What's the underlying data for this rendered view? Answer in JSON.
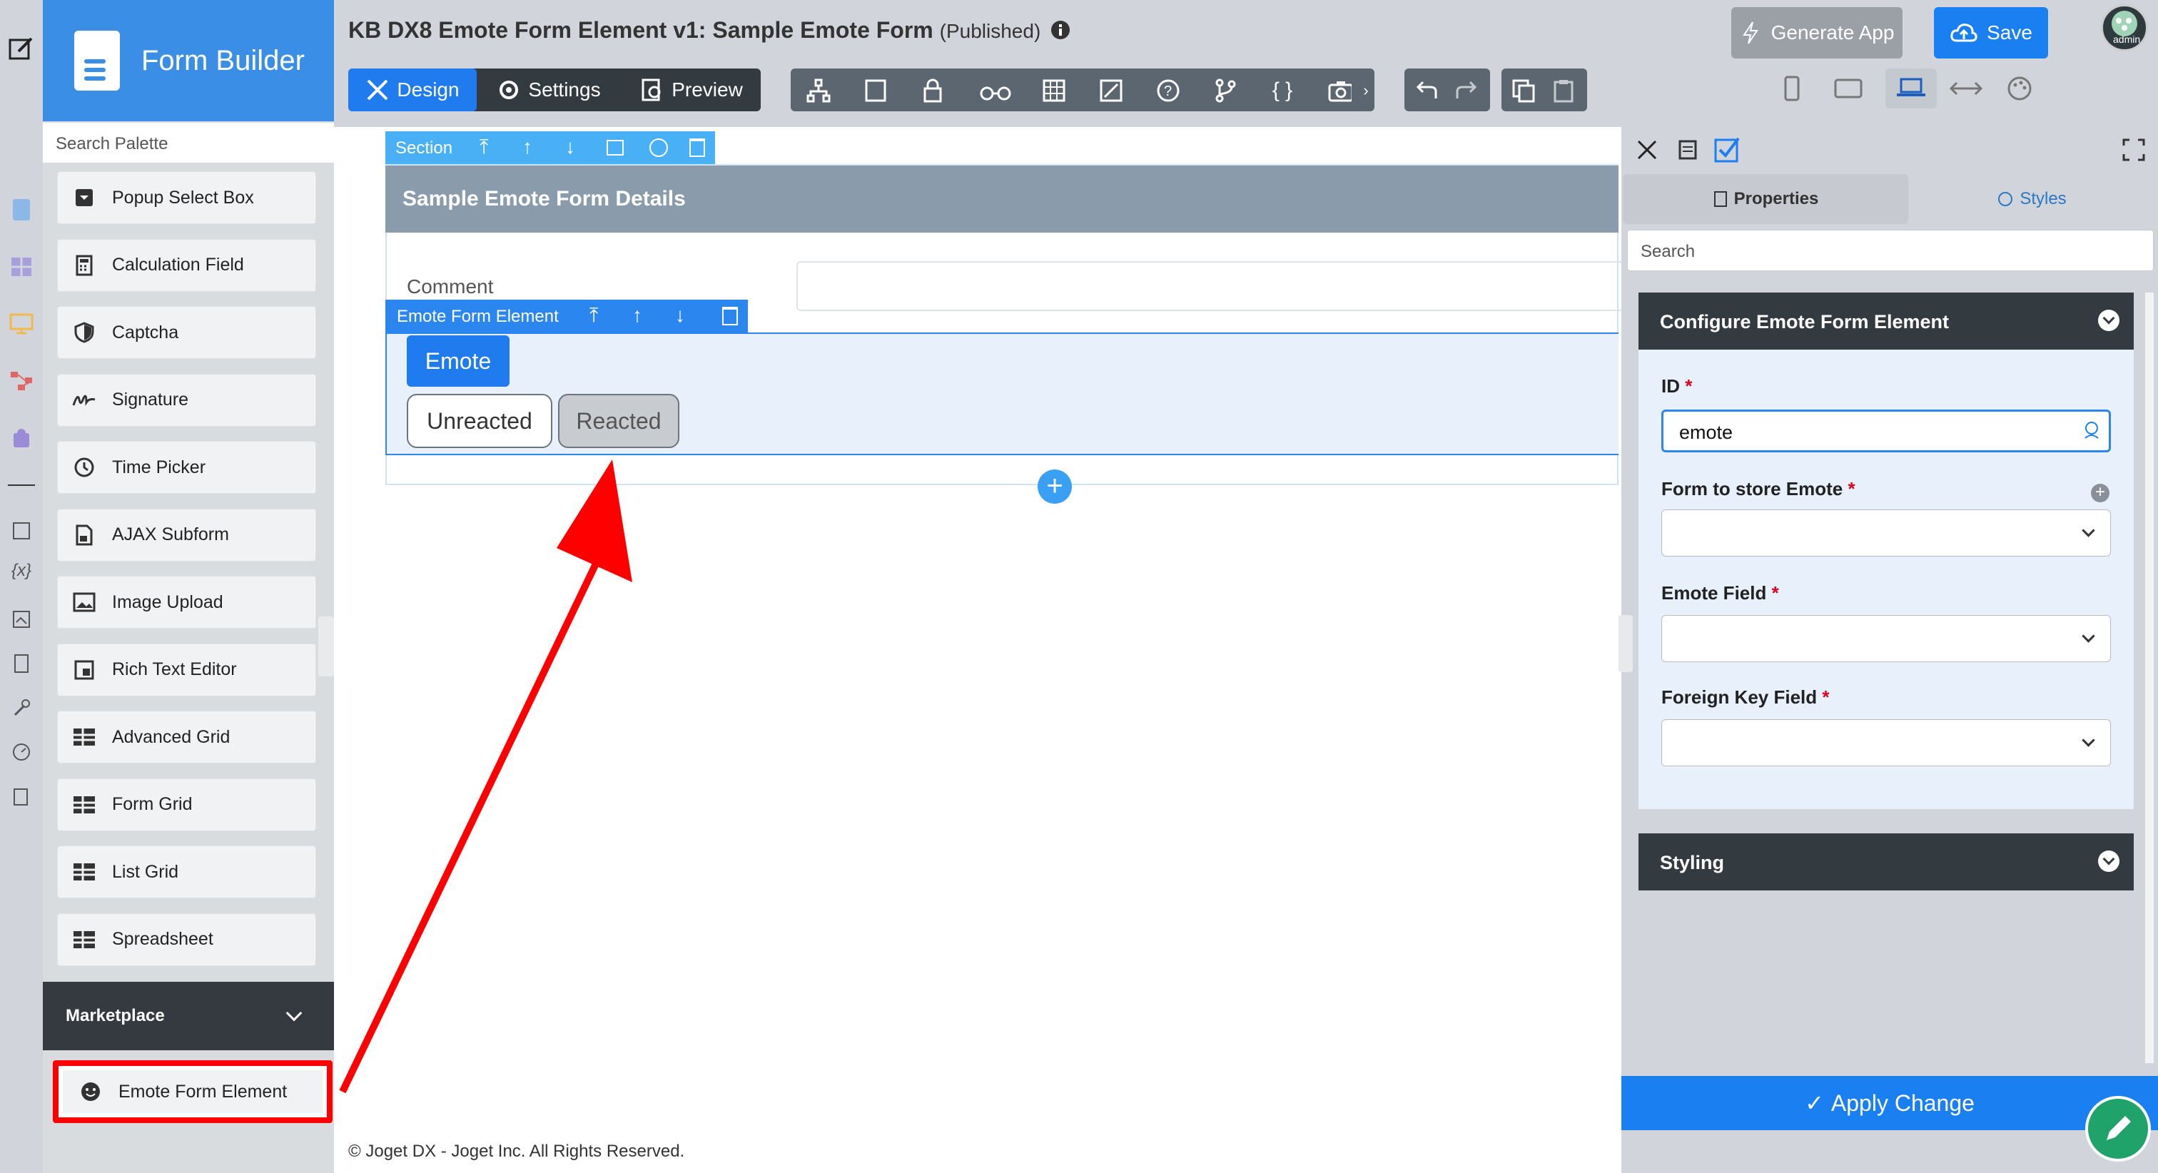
{
  "app": {
    "name": "Form Builder"
  },
  "palette": {
    "search_placeholder": "Search Palette",
    "items": [
      {
        "label": "Popup Select Box",
        "icon": "popup-select-icon"
      },
      {
        "label": "Calculation Field",
        "icon": "calculator-icon"
      },
      {
        "label": "Captcha",
        "icon": "shield-icon"
      },
      {
        "label": "Signature",
        "icon": "signature-icon"
      },
      {
        "label": "Time Picker",
        "icon": "clock-icon"
      },
      {
        "label": "AJAX Subform",
        "icon": "document-icon"
      },
      {
        "label": "Image Upload",
        "icon": "image-icon"
      },
      {
        "label": "Rich Text Editor",
        "icon": "rich-text-icon"
      },
      {
        "label": "Advanced Grid",
        "icon": "grid-icon"
      },
      {
        "label": "Form Grid",
        "icon": "grid-icon"
      },
      {
        "label": "List Grid",
        "icon": "grid-icon"
      },
      {
        "label": "Spreadsheet",
        "icon": "grid-icon"
      }
    ],
    "marketplace_label": "Marketplace",
    "marketplace_item": {
      "label": "Emote Form Element",
      "icon": "smiley-icon"
    }
  },
  "header": {
    "title": "KB DX8 Emote Form Element v1: Sample Emote Form",
    "status": "(Published)",
    "modes": [
      {
        "label": "Design",
        "active": true
      },
      {
        "label": "Settings",
        "active": false
      },
      {
        "label": "Preview",
        "active": false
      }
    ],
    "generate_app_label": "Generate App",
    "save_label": "Save",
    "user": "admin"
  },
  "canvas": {
    "section_tab_label": "Section",
    "section_title": "Sample Emote Form Details",
    "comment_label": "Comment",
    "element_tab_label": "Emote Form Element",
    "emote_button_label": "Emote",
    "unreacted_label": "Unreacted",
    "reacted_label": "Reacted"
  },
  "footer": {
    "text": "© Joget DX - Joget Inc. All Rights Reserved."
  },
  "properties_panel": {
    "tab_properties": "Properties",
    "tab_styles": "Styles",
    "search_placeholder": "Search",
    "config_title": "Configure Emote Form Element",
    "id_label": "ID",
    "id_value": "emote",
    "form_label": "Form to store Emote",
    "emote_field_label": "Emote Field",
    "foreign_key_label": "Foreign Key Field",
    "styling_title": "Styling",
    "apply_label": "Apply Change"
  },
  "colors": {
    "brand_blue": "#3a8ee6",
    "primary": "#1f7bee",
    "dark": "#333a40",
    "annotation_red": "#ff0000",
    "required": "#e0001a"
  }
}
